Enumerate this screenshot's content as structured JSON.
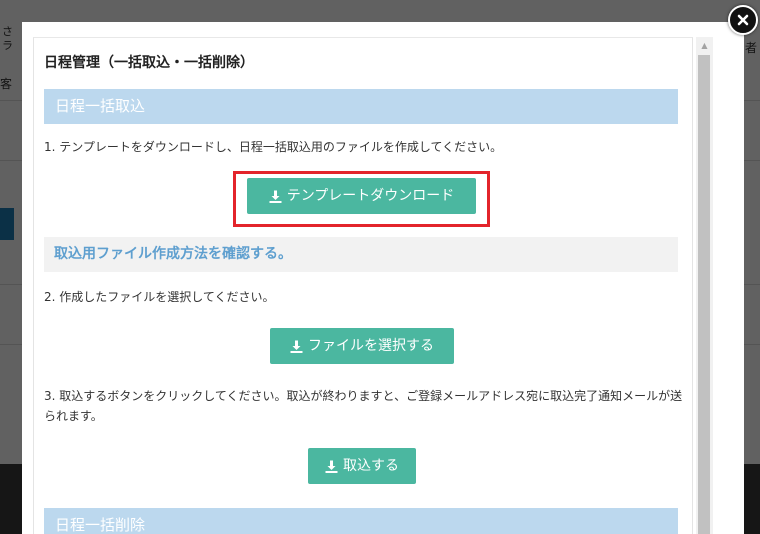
{
  "modal": {
    "title": "日程管理（一括取込・一括削除）",
    "import_section": {
      "heading": "日程一括取込",
      "step1": "1.  テンプレートをダウンロードし、日程一括取込用のファイルを作成してください。",
      "download_button": "テンプレートダウンロード",
      "howto_link": "取込用ファイル作成方法を確認する。",
      "step2": "2.  作成したファイルを選択してください。",
      "select_file_button": "ファイルを選択する",
      "step3": "3.  取込するボタンをクリックしてください。取込が終わりますと、ご登録メールアドレス宛に取込完了通知メールが送られます。",
      "import_button": "取込する"
    },
    "delete_section": {
      "heading": "日程一括削除"
    }
  },
  "background": {
    "frag1": "さ",
    "frag2": "ラ",
    "frag3": "客",
    "frag4": "者"
  },
  "colors": {
    "button": "#4bb7a0",
    "section_header": "#bcd8ee",
    "link": "#5e9fcf",
    "highlight": "#e3242b"
  },
  "icons": {
    "button_icon": "download-icon",
    "close": "close-icon"
  }
}
